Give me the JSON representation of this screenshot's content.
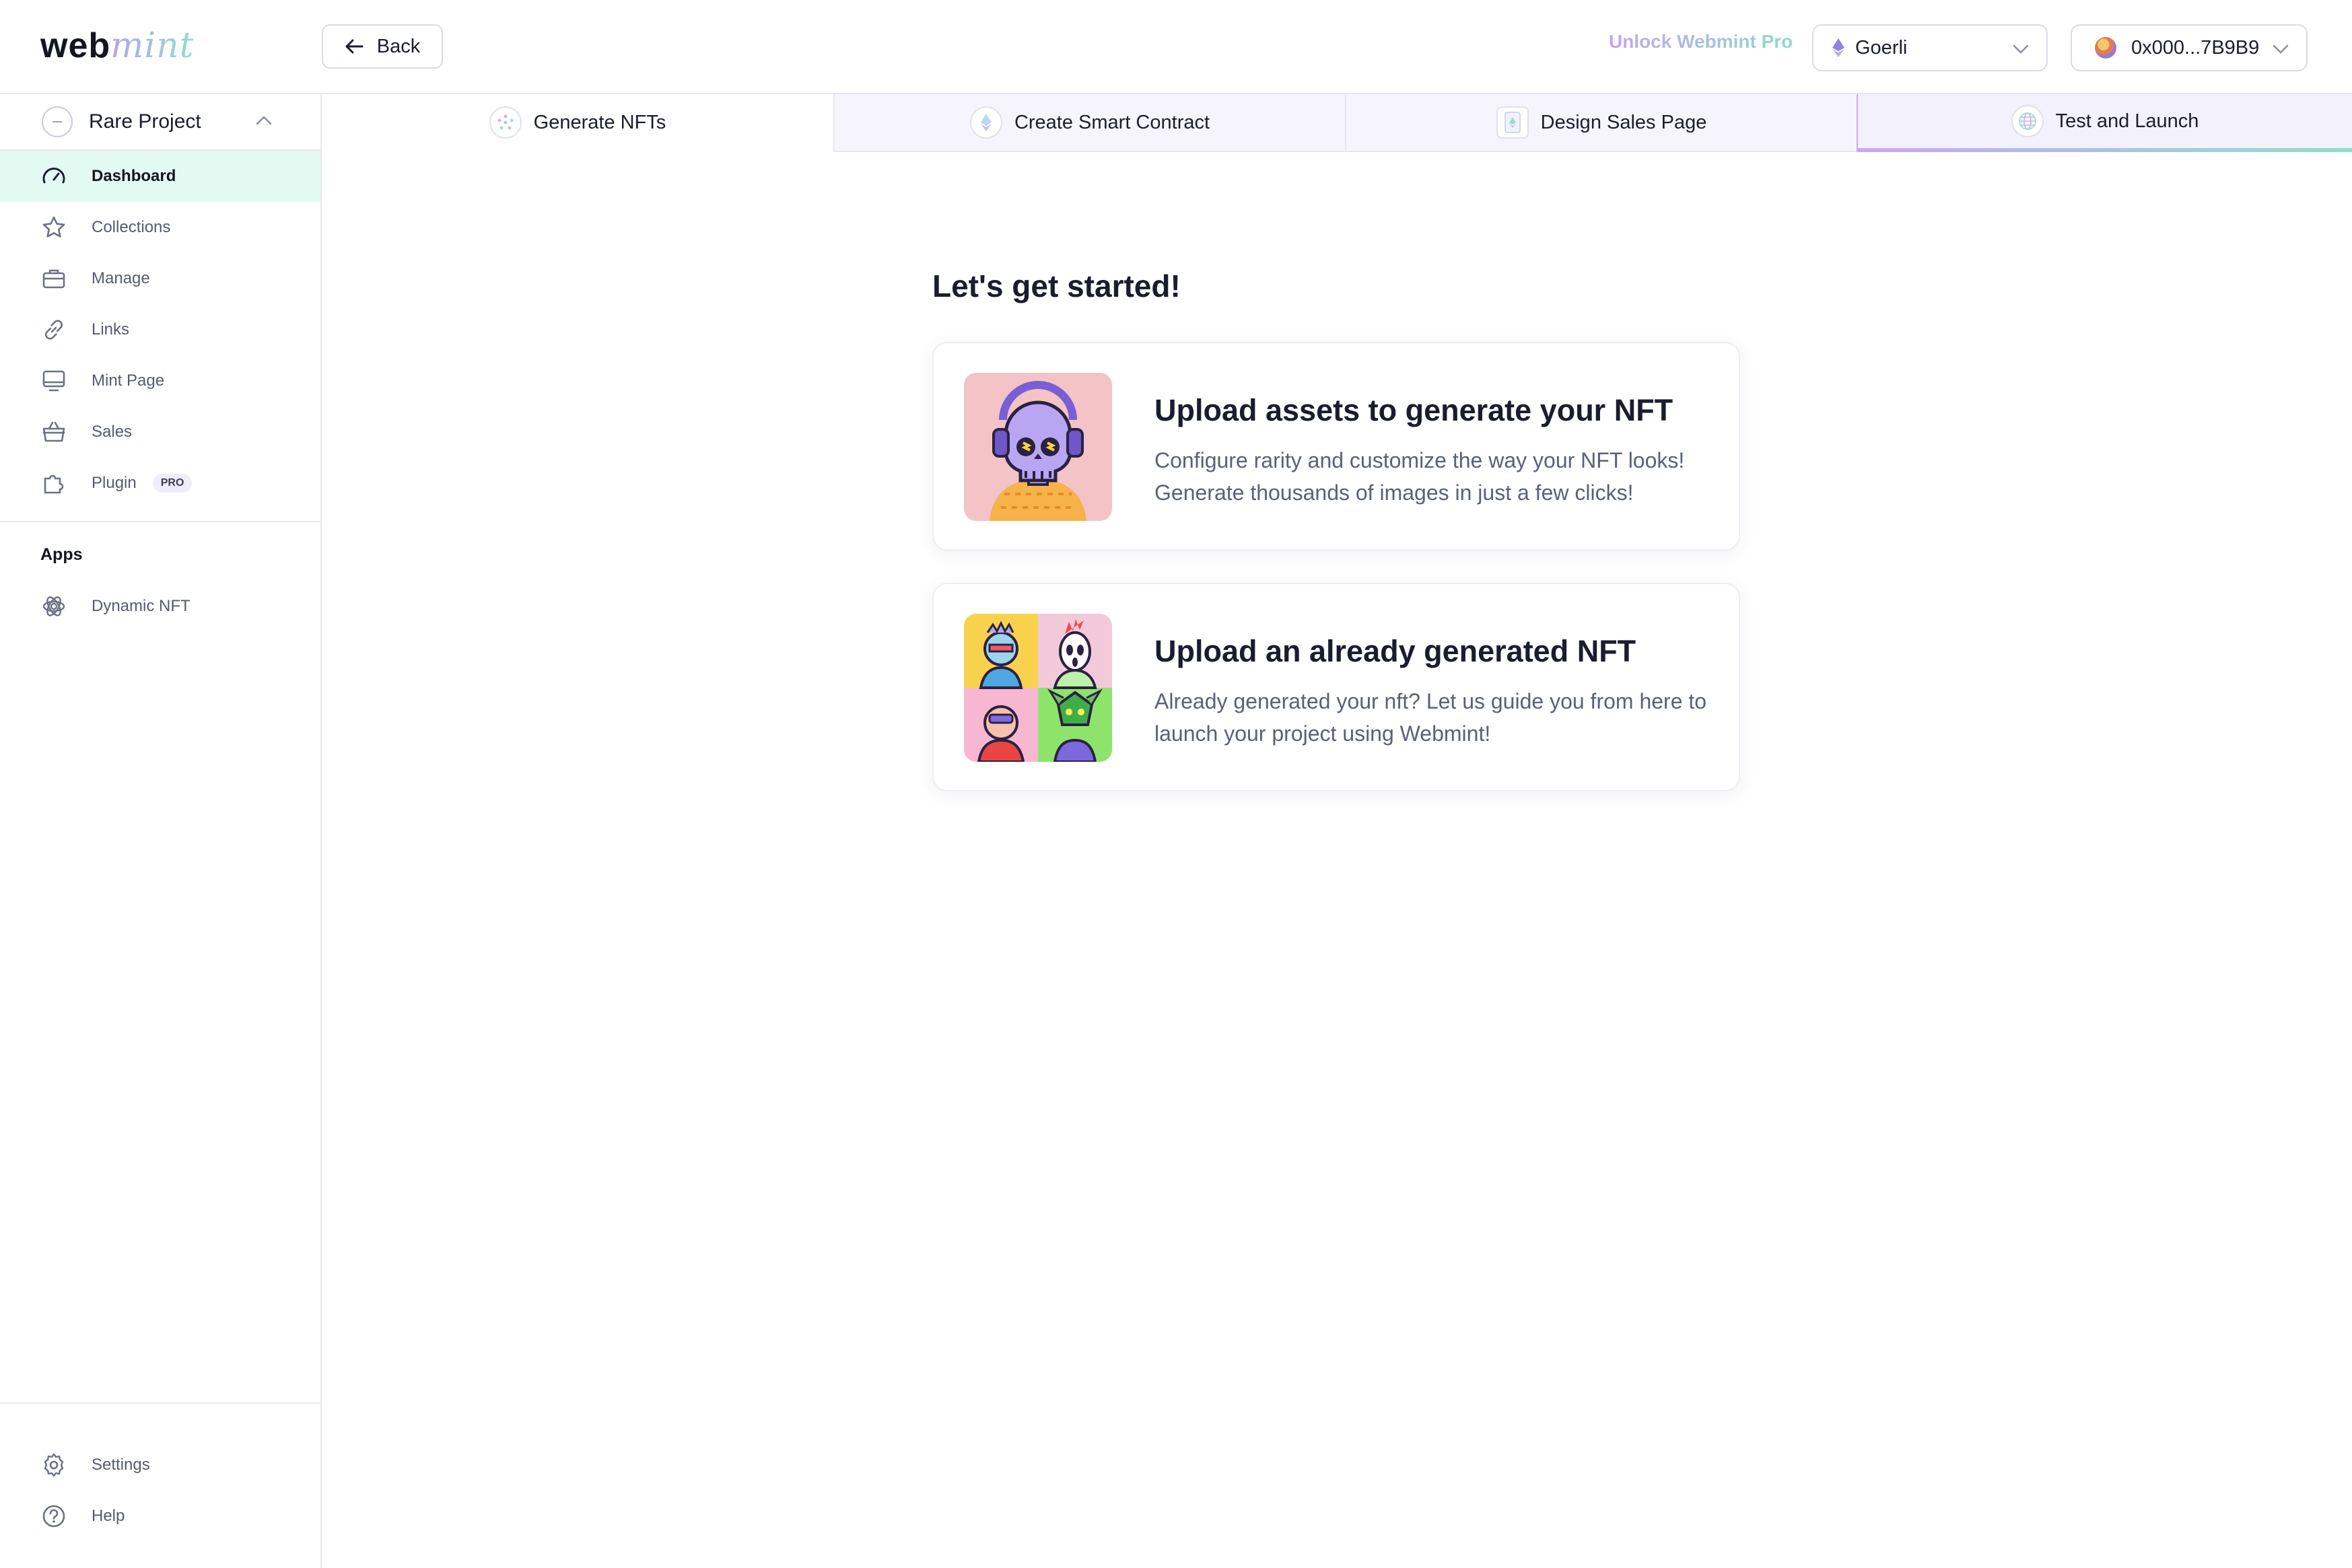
{
  "header": {
    "logo_part1": "web",
    "logo_part2": "mint",
    "back_label": "Back",
    "unlock_label": "Unlock Webmint Pro",
    "network_value": "Goerli",
    "wallet_value": "0x000...7B9B9"
  },
  "sidebar": {
    "project_name": "Rare Project",
    "items": [
      {
        "label": "Dashboard",
        "icon": "gauge-icon",
        "active": true
      },
      {
        "label": "Collections",
        "icon": "star-icon"
      },
      {
        "label": "Manage",
        "icon": "briefcase-icon"
      },
      {
        "label": "Links",
        "icon": "link-icon"
      },
      {
        "label": "Mint Page",
        "icon": "monitor-icon"
      },
      {
        "label": "Sales",
        "icon": "basket-icon"
      },
      {
        "label": "Plugin",
        "icon": "puzzle-icon",
        "badge": "PRO"
      }
    ],
    "apps_title": "Apps",
    "apps": [
      {
        "label": "Dynamic NFT",
        "icon": "atom-icon"
      }
    ],
    "footer": [
      {
        "label": "Settings",
        "icon": "gear-icon"
      },
      {
        "label": "Help",
        "icon": "help-icon"
      }
    ]
  },
  "tabs": [
    {
      "label": "Generate NFTs",
      "active": true
    },
    {
      "label": "Create Smart Contract"
    },
    {
      "label": "Design Sales Page"
    },
    {
      "label": "Test and Launch"
    }
  ],
  "main": {
    "heading": "Let's get started!",
    "cards": [
      {
        "title": "Upload assets to generate your NFT",
        "description": "Configure rarity and customize the way your NFT looks! Generate thousands of images in just a few clicks!"
      },
      {
        "title": "Upload an already generated NFT",
        "description": "Already generated your nft? Let us guide you from here to launch your project using Webmint!"
      }
    ]
  },
  "colors": {
    "active_nav_bg": "#e3faf2",
    "accent_purple": "#c3a5f2",
    "accent_mint": "#8fdcc8",
    "border": "#e6e8ee"
  }
}
